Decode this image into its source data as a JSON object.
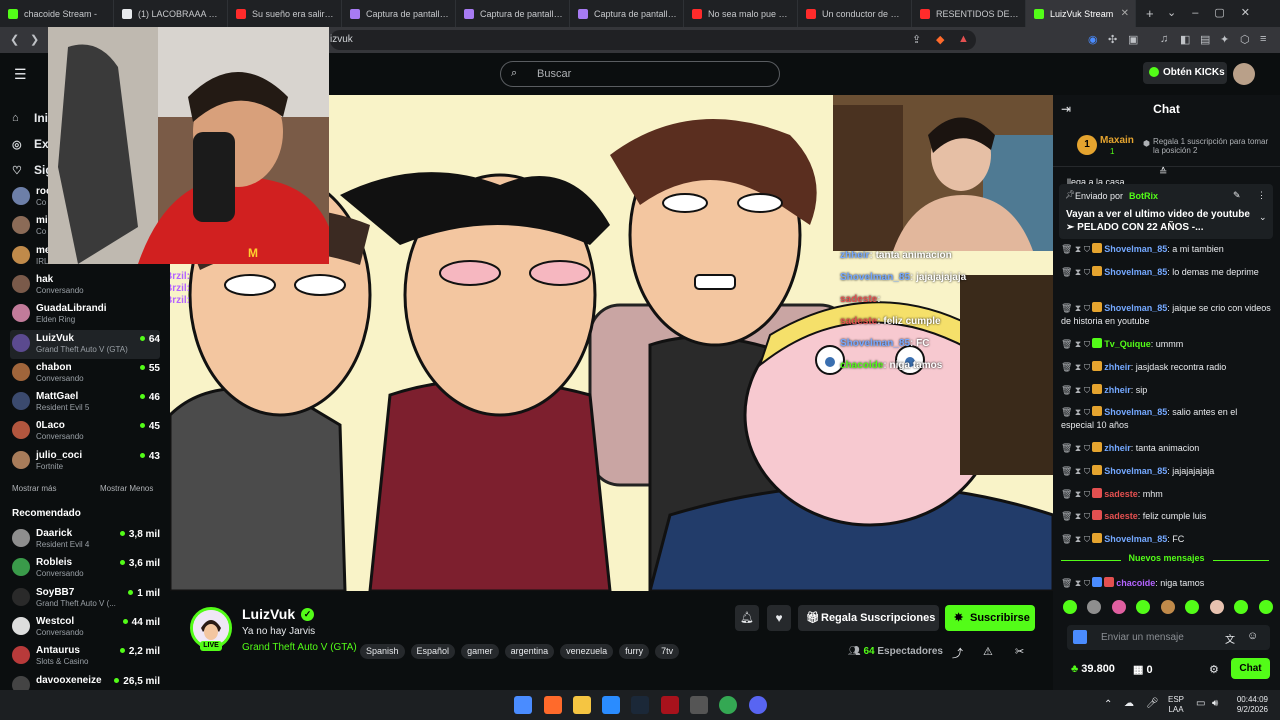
{
  "browser": {
    "tabs": [
      {
        "title": "chacoide Stream -",
        "color": "#53fc18"
      },
      {
        "title": "(1) LACOBRAAA Out of",
        "color": "#e8eaed"
      },
      {
        "title": "Su sueño era salir en P",
        "color": "#ff2b2b"
      },
      {
        "title": "Captura de pantalla po",
        "color": "#a77bf3"
      },
      {
        "title": "Captura de pantalla po",
        "color": "#a77bf3"
      },
      {
        "title": "Captura de pantalla po",
        "color": "#a77bf3"
      },
      {
        "title": "No sea malo pue papi",
        "color": "#ff2b2b"
      },
      {
        "title": "Un conductor de San J",
        "color": "#ff2b2b"
      },
      {
        "title": "RESENTIDOS DE LA GE",
        "color": "#ff2b2b"
      },
      {
        "title": "LuizVuk Stream",
        "color": "#53fc18",
        "active": true
      }
    ],
    "new_tab": "+",
    "address": "izvuk"
  },
  "header": {
    "search_placeholder": "Buscar",
    "get_kicks": "Obtén KICKs"
  },
  "sidebar": {
    "nav": [
      {
        "label": "Inic",
        "icon": "home-icon"
      },
      {
        "label": "Exp",
        "icon": "compass-icon"
      },
      {
        "label": "Sig",
        "icon": "heart-icon"
      }
    ],
    "following": [
      {
        "name": "roc",
        "sub": "Co",
        "count": "",
        "color": "#6d7fa8"
      },
      {
        "name": "mis",
        "sub": "Co",
        "count": "",
        "color": "#8b6b57"
      },
      {
        "name": "me",
        "sub": "IRL",
        "count": "",
        "color": "#c08a4a"
      },
      {
        "name": "hak",
        "sub": "Conversando",
        "count": "",
        "color": "#7a5a4a"
      },
      {
        "name": "GuadaLibrandi",
        "sub": "Elden Ring",
        "count": "",
        "color": "#c27b9a"
      },
      {
        "name": "LuizVuk",
        "sub": "Grand Theft Auto V (GTA)",
        "count": "64",
        "color": "#5b4a8f",
        "active": true
      },
      {
        "name": "chabon",
        "sub": "Conversando",
        "count": "55",
        "color": "#a0653b"
      },
      {
        "name": "MattGael",
        "sub": "Resident Evil 5",
        "count": "46",
        "color": "#3b4a6e"
      },
      {
        "name": "0Laco",
        "sub": "Conversando",
        "count": "45",
        "color": "#b2563e"
      },
      {
        "name": "julio_coci",
        "sub": "Fortnite",
        "count": "43",
        "color": "#a87c5a"
      }
    ],
    "show_more": "Mostrar más",
    "show_less": "Mostrar Menos",
    "recommended_title": "Recomendado",
    "recommended": [
      {
        "name": "Daarick",
        "sub": "Resident Evil 4",
        "count": "3,8 mil",
        "color": "#8e8e8e"
      },
      {
        "name": "Robleis",
        "sub": "Conversando",
        "count": "3,6 mil",
        "color": "#3a9a4a"
      },
      {
        "name": "SoyBB7",
        "sub": "Grand Theft Auto V (...",
        "count": "1 mil",
        "color": "#2a2a2a"
      },
      {
        "name": "Westcol",
        "sub": "Conversando",
        "count": "44 mil",
        "color": "#dddddd"
      },
      {
        "name": "Antaurus",
        "sub": "Slots & Casino",
        "count": "2,2 mil",
        "color": "#b83a3a"
      },
      {
        "name": "davooxeneize",
        "sub": "",
        "count": "26,5 mil",
        "color": "#444444"
      }
    ]
  },
  "video": {
    "overlay_chat": [
      {
        "user": "zhheir",
        "text": "tanta animacion"
      },
      {
        "user": "Shovelman_85",
        "text": "jajajajajaja"
      },
      {
        "user": "sadeste",
        "text": ""
      },
      {
        "user": "sadeste",
        "text": "feliz cumple"
      },
      {
        "user": "Shovelman_85",
        "text": "FC"
      },
      {
        "user": "chacoide",
        "text": "niga tamos"
      }
    ],
    "left_overlay": [
      {
        "user": "KauaBrzil:"
      },
      {
        "user": "KauaBrzil:"
      },
      {
        "user": "KauaBrzil:"
      }
    ]
  },
  "stream": {
    "name": "LuizVuk",
    "live": "LIVE",
    "title": "Ya no hay Jarvis",
    "category": "Grand Theft Auto V (GTA)",
    "tags": [
      "Spanish",
      "Español",
      "gamer",
      "argentina",
      "venezuela",
      "furry",
      "7tv"
    ],
    "gift_label": "Regala Suscripciones",
    "subscribe_label": "Suscribirse",
    "viewers": "64",
    "viewers_label": "Espectadores"
  },
  "chat": {
    "title": "Chat",
    "top_gifter": {
      "rank": "1",
      "name": "Maxain",
      "count": "1",
      "info": "Regala 1 suscripción para tomar la posición 2"
    },
    "partial_line": "llega a la casa",
    "pinned": {
      "by": "Enviado por",
      "user": "BotRix",
      "text": "Vayan a ver el ultimo video de youtube ➢ PELADO CON 22 AÑOS -..."
    },
    "messages": [
      {
        "user": "Shovelman_85",
        "text": ": a mi tambien",
        "color": "blue"
      },
      {
        "user": "Shovelman_85",
        "text": ": lo demas me deprime",
        "color": "blue"
      },
      {
        "user": "Shovelman_85",
        "text": ": jaique se crio con videos de historia en youtube",
        "color": "blue"
      },
      {
        "user": "Tv_Quique",
        "text": ": ummm",
        "color": "green"
      },
      {
        "user": "zhheir",
        "text": ": jasjdask recontra radio",
        "color": "blue"
      },
      {
        "user": "zhheir",
        "text": ": sip",
        "color": "blue"
      },
      {
        "user": "Shovelman_85",
        "text": ": salio antes en el especial 10 años",
        "color": "blue"
      },
      {
        "user": "zhheir",
        "text": ": tanta animacion",
        "color": "blue"
      },
      {
        "user": "Shovelman_85",
        "text": ": jajajajajaja",
        "color": "blue"
      },
      {
        "user": "sadeste",
        "text": ": mhm",
        "color": "red"
      },
      {
        "user": "sadeste",
        "text": ": feliz cumple luis",
        "color": "red"
      },
      {
        "user": "Shovelman_85",
        "text": ": FC",
        "color": "blue"
      }
    ],
    "new_messages": "Nuevos mensajes",
    "last_message": {
      "user": "chacoide",
      "text": ": niga tamos",
      "color": "purple"
    },
    "input_placeholder": "Enviar un mensaje",
    "kicks_balance": "39.800",
    "gifts_count": "0",
    "send_label": "Chat"
  },
  "taskbar": {
    "lang": "ESP",
    "region": "LAA",
    "time": "00:44:09",
    "date": "9/2/2026"
  }
}
